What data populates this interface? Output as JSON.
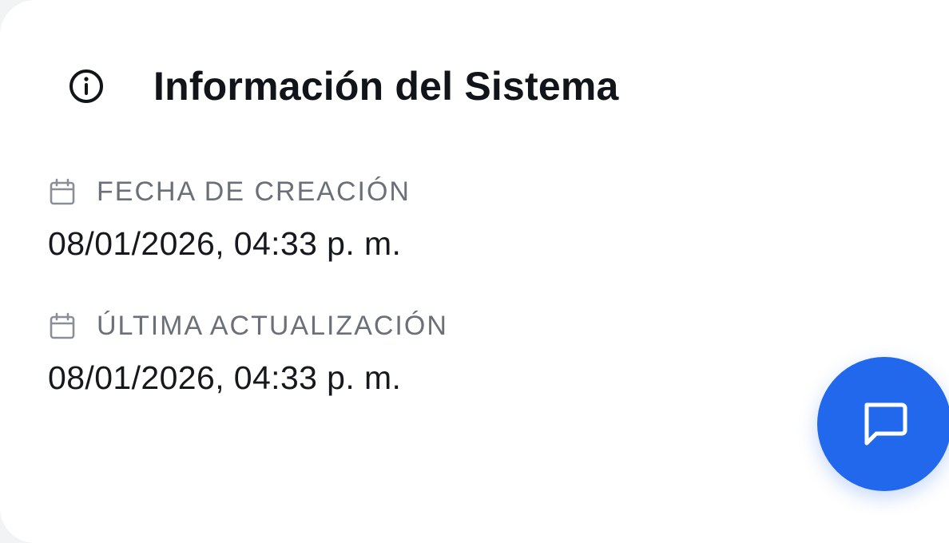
{
  "section": {
    "title": "Información del Sistema",
    "icon": "info-icon"
  },
  "fields": [
    {
      "label": "FECHA DE CREACIÓN",
      "value": "08/01/2026, 04:33 p. m.",
      "icon": "calendar-icon"
    },
    {
      "label": "ÚLTIMA ACTUALIZACIÓN",
      "value": "08/01/2026, 04:33 p. m.",
      "icon": "calendar-icon"
    }
  ],
  "chat_button": {
    "icon": "chat-icon",
    "color": "#2168ec"
  }
}
